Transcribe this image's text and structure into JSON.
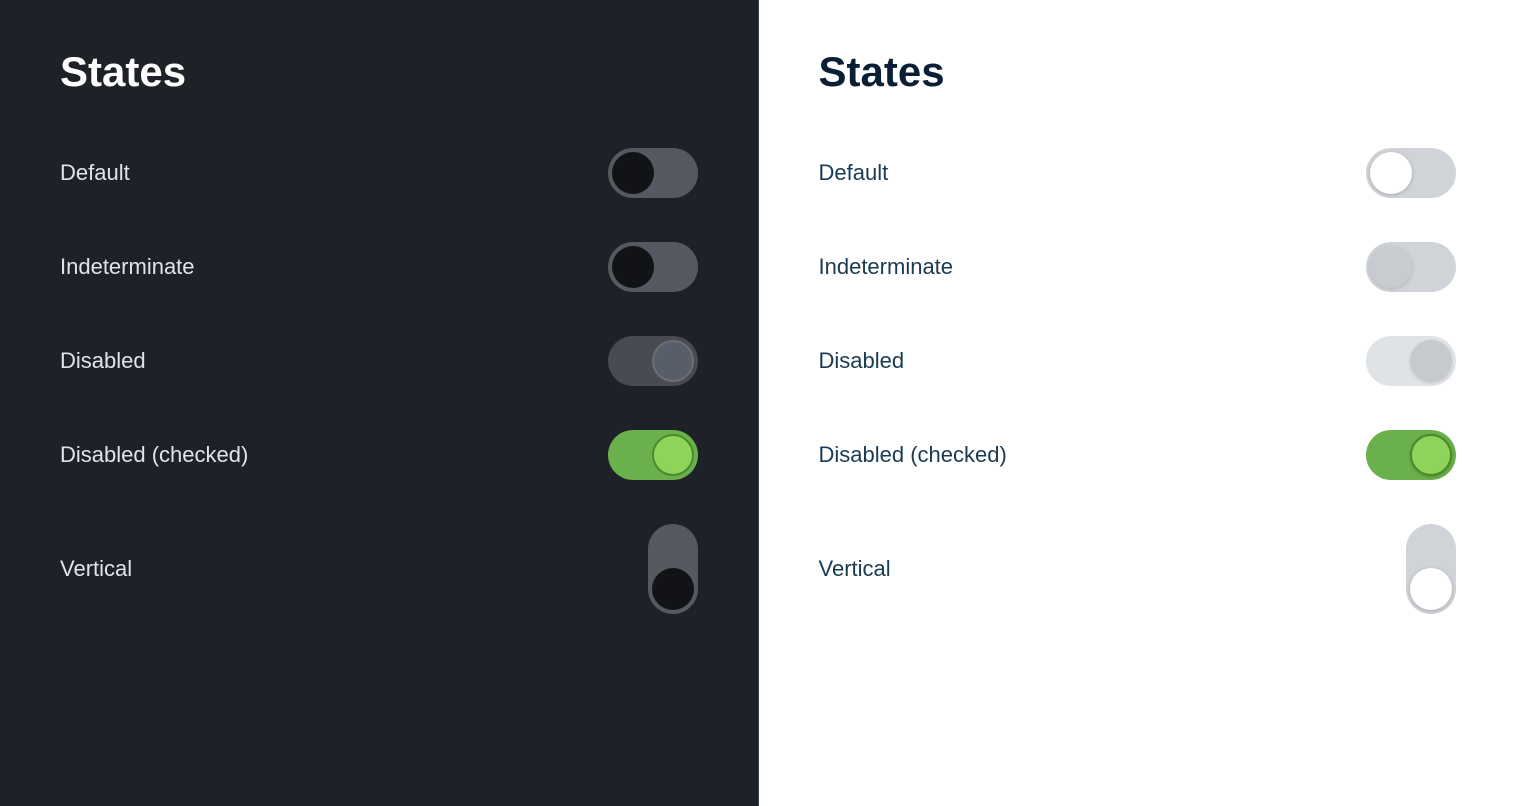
{
  "panels": [
    {
      "id": "dark",
      "title": "States",
      "theme": "dark",
      "states": [
        {
          "id": "default",
          "label": "Default"
        },
        {
          "id": "indeterminate",
          "label": "Indeterminate"
        },
        {
          "id": "disabled",
          "label": "Disabled"
        },
        {
          "id": "disabled-checked",
          "label": "Disabled (checked)"
        },
        {
          "id": "vertical",
          "label": "Vertical"
        }
      ]
    },
    {
      "id": "light",
      "title": "States",
      "theme": "light",
      "states": [
        {
          "id": "default",
          "label": "Default"
        },
        {
          "id": "indeterminate",
          "label": "Indeterminate"
        },
        {
          "id": "disabled",
          "label": "Disabled"
        },
        {
          "id": "disabled-checked",
          "label": "Disabled (checked)"
        },
        {
          "id": "vertical",
          "label": "Vertical"
        }
      ]
    }
  ]
}
